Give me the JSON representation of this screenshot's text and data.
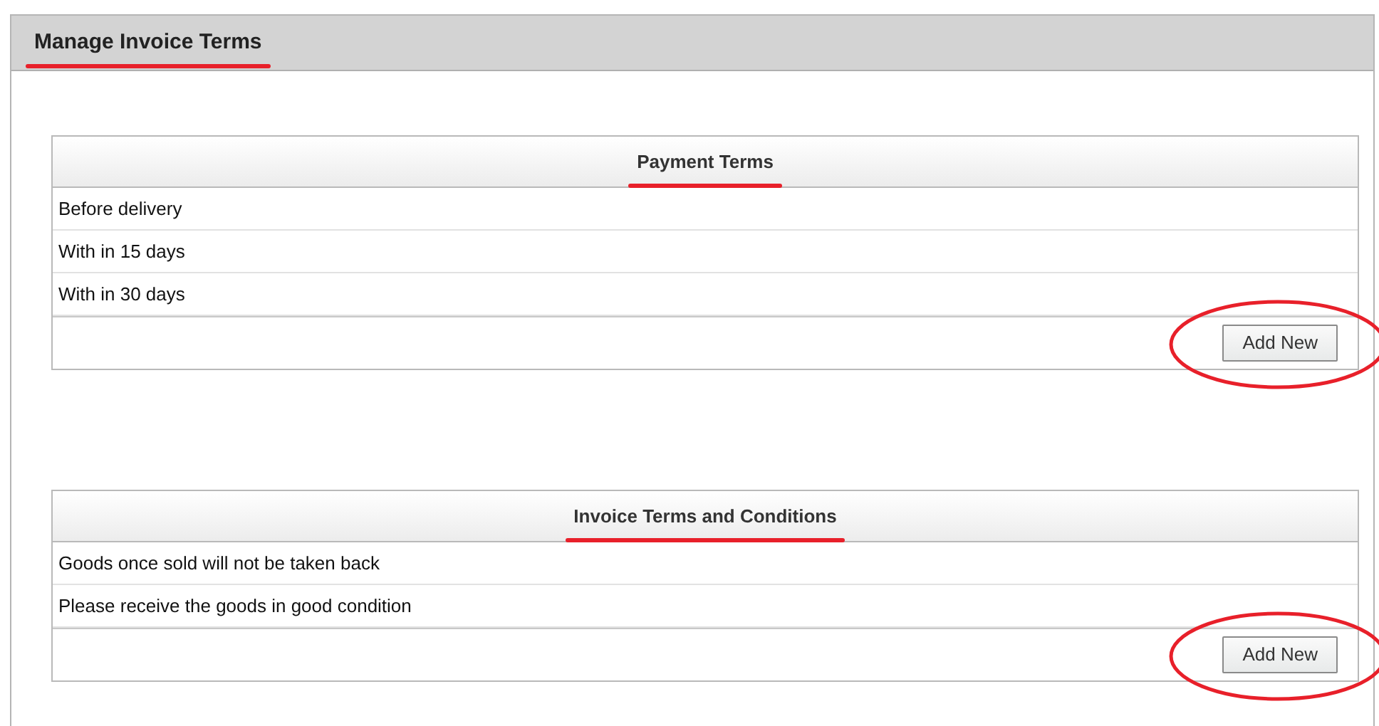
{
  "page": {
    "title": "Manage Invoice Terms",
    "highlighted": true
  },
  "sections": [
    {
      "title": "Payment Terms",
      "highlighted": true,
      "rows": [
        "Before delivery",
        "With in 15 days",
        "With in 30 days"
      ],
      "button": {
        "label": "Add New",
        "highlighted": true
      }
    },
    {
      "title": "Invoice Terms and Conditions",
      "highlighted": true,
      "rows": [
        "Goods once sold will not be taken back",
        "Please receive the goods in good condition"
      ],
      "button": {
        "label": "Add New",
        "highlighted": true
      }
    }
  ]
}
